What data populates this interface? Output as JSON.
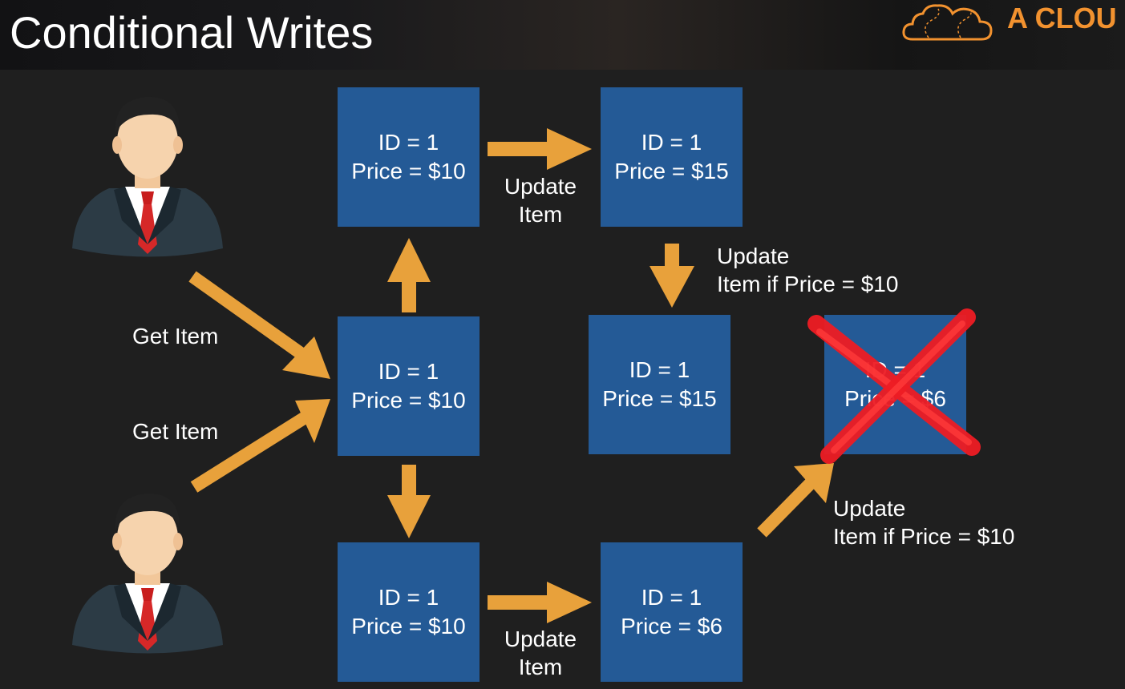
{
  "title": "Conditional Writes",
  "brand": {
    "text": "A CLOU",
    "color": "#f2922f"
  },
  "colors": {
    "box": "#245a96",
    "arrow": "#e8a13b",
    "cross": "#ee1c24",
    "background": "#1f1f1f"
  },
  "boxes": {
    "get_source": {
      "id": "ID = 1",
      "price": "Price = $10"
    },
    "top_left": {
      "id": "ID = 1",
      "price": "Price = $10"
    },
    "top_right": {
      "id": "ID = 1",
      "price": "Price = $15"
    },
    "mid_right": {
      "id": "ID = 1",
      "price": "Price = $15"
    },
    "rejected": {
      "id": "ID = 1",
      "price": "Price = $6"
    },
    "bottom_left": {
      "id": "ID = 1",
      "price": "Price = $10"
    },
    "bottom_right": {
      "id": "ID = 1",
      "price": "Price = $6"
    }
  },
  "labels": {
    "get_item_top": "Get Item",
    "get_item_bottom": "Get Item",
    "update_top": {
      "line1": "Update",
      "line2": "Item"
    },
    "update_bottom": {
      "line1": "Update",
      "line2": "Item"
    },
    "conditional_top": {
      "line1": "Update",
      "line2": "Item if Price = $10"
    },
    "conditional_bottom": {
      "line1": "Update",
      "line2": "Item if Price = $10"
    }
  },
  "icons": [
    "cloud-logo-icon",
    "businessman-icon",
    "businessman-icon",
    "arrow-icon",
    "cross-icon"
  ]
}
